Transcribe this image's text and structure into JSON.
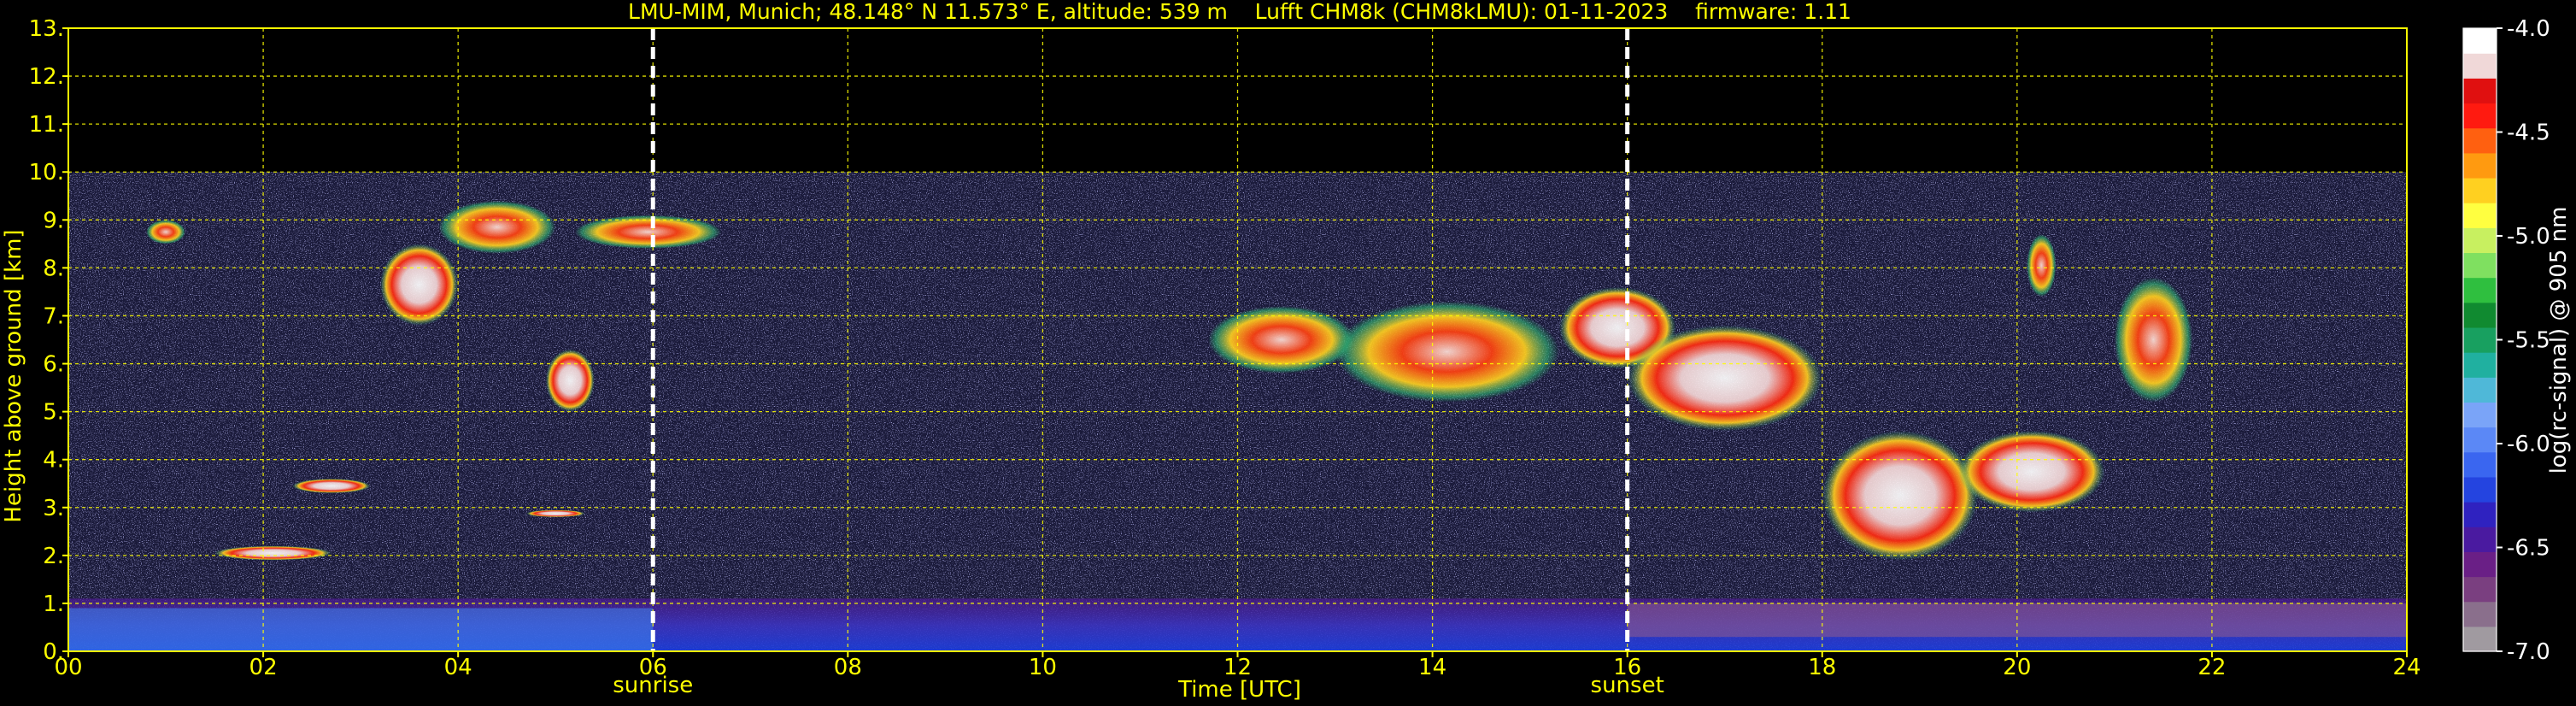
{
  "chart_data": {
    "type": "heatmap",
    "title": "LMU-MIM, Munich; 48.148° N 11.573° E, altitude: 539 m    Lufft CHM8k (CHM8kLMU): 01-11-2023    firmware: 1.11",
    "xlabel": "Time [UTC]",
    "ylabel": "Height above ground [km]",
    "xlim": [
      0,
      24
    ],
    "ylim": [
      0,
      13
    ],
    "x_ticks": [
      "00",
      "02",
      "04",
      "06",
      "08",
      "10",
      "12",
      "14",
      "16",
      "18",
      "20",
      "22",
      "24"
    ],
    "y_ticks": [
      "0.",
      "1.",
      "2.",
      "3.",
      "4.",
      "5.",
      "6.",
      "7.",
      "8.",
      "9.",
      "10.",
      "11.",
      "12.",
      "13."
    ],
    "grid": true,
    "data_top_km": 10,
    "events": [
      {
        "label": "sunrise",
        "time": 6.0
      },
      {
        "label": "sunset",
        "time": 16.0
      }
    ],
    "colorbar": {
      "label": "log(rc-signal) @ 905 nm",
      "range": [
        -7.0,
        -4.0
      ],
      "ticks": [
        "-4.0",
        "-4.5",
        "-5.0",
        "-5.5",
        "-6.0",
        "-6.5",
        "-7.0"
      ],
      "colors": [
        "#a09aa0",
        "#8a6f8c",
        "#7a3f80",
        "#6a1f86",
        "#4a1aa0",
        "#2f22c0",
        "#2444e0",
        "#3a66f0",
        "#5b88f6",
        "#7aa4f8",
        "#4fb8d8",
        "#20b0a0",
        "#18a060",
        "#108a30",
        "#2fbf3f",
        "#7fe060",
        "#c8f060",
        "#ffff40",
        "#ffd020",
        "#ff9a10",
        "#ff6010",
        "#ff1a10",
        "#e01010",
        "#f0d8d8",
        "#ffffff"
      ]
    },
    "cloud_layers": [
      {
        "start": 0.8,
        "end": 1.2,
        "base": 8.5,
        "top": 9.0,
        "intensity": "medium"
      },
      {
        "start": 1.5,
        "end": 2.7,
        "base": 1.9,
        "top": 2.2,
        "intensity": "high"
      },
      {
        "start": 2.3,
        "end": 3.1,
        "base": 3.3,
        "top": 3.6,
        "intensity": "high"
      },
      {
        "start": 3.2,
        "end": 4.0,
        "base": 6.8,
        "top": 8.5,
        "intensity": "high"
      },
      {
        "start": 3.8,
        "end": 5.0,
        "base": 8.3,
        "top": 9.4,
        "intensity": "medium"
      },
      {
        "start": 4.7,
        "end": 5.3,
        "base": 2.8,
        "top": 2.95,
        "intensity": "high"
      },
      {
        "start": 4.9,
        "end": 5.4,
        "base": 5.0,
        "top": 6.3,
        "intensity": "high"
      },
      {
        "start": 5.2,
        "end": 6.7,
        "base": 8.4,
        "top": 9.1,
        "intensity": "medium"
      },
      {
        "start": 11.7,
        "end": 13.2,
        "base": 5.8,
        "top": 7.2,
        "intensity": "medium"
      },
      {
        "start": 13.0,
        "end": 15.3,
        "base": 5.2,
        "top": 7.3,
        "intensity": "medium"
      },
      {
        "start": 15.3,
        "end": 16.5,
        "base": 5.9,
        "top": 7.6,
        "intensity": "high"
      },
      {
        "start": 16.0,
        "end": 18.0,
        "base": 4.6,
        "top": 6.8,
        "intensity": "high"
      },
      {
        "start": 18.0,
        "end": 19.6,
        "base": 1.9,
        "top": 4.6,
        "intensity": "high"
      },
      {
        "start": 19.4,
        "end": 20.9,
        "base": 2.9,
        "top": 4.6,
        "intensity": "high"
      },
      {
        "start": 20.1,
        "end": 20.4,
        "base": 7.4,
        "top": 8.7,
        "intensity": "medium"
      },
      {
        "start": 21.0,
        "end": 21.8,
        "base": 5.2,
        "top": 7.8,
        "intensity": "medium"
      }
    ]
  }
}
